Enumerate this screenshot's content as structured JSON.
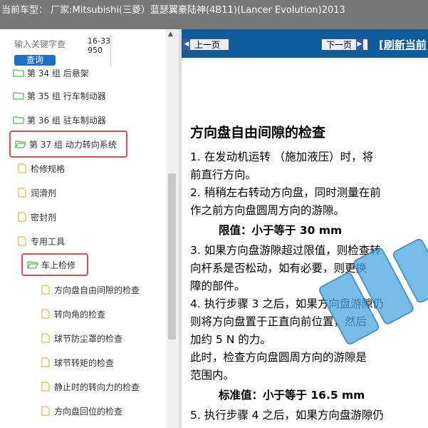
{
  "header": {
    "title": "当前车型： 厂家:Mitsubishi(三菱）蓝瑟翼豪陆神(4B11)(Lancer Evolution)2013"
  },
  "search": {
    "placeholder": "输入关键字查",
    "button_label": "查询",
    "code_text": "16-33950"
  },
  "tree": {
    "groups": [
      {
        "label": "第 34 组 后悬架"
      },
      {
        "label": "第 35 组 行车制动器"
      },
      {
        "label": "第 36 组 驻车制动器"
      },
      {
        "label": "第 37 组 动力转向系统"
      }
    ],
    "children": [
      {
        "label": "检修规格"
      },
      {
        "label": "润滑剂"
      },
      {
        "label": "密封剂"
      },
      {
        "label": "专用工具"
      }
    ],
    "subfolder": {
      "label": "车上检修"
    },
    "leaves": [
      {
        "label": "方向盘自由间隙的检查"
      },
      {
        "label": "转向角的检查"
      },
      {
        "label": "球节防尘罩的检查"
      },
      {
        "label": "球节转矩的检查"
      },
      {
        "label": "静止时的转向力的检查"
      },
      {
        "label": "方向盘回位的检查"
      }
    ]
  },
  "nav": {
    "prev_label": "上一页",
    "next_label": "下一页",
    "refresh_label": "[刷新当前"
  },
  "document": {
    "heading": "方向盘自由间隙的检查",
    "lines": [
      "1. 在发动机运转 （施加液压）时，将",
      "   前直行方向。",
      "2. 稍稍左右转动方向盘，同时测量在前",
      "   作之前方向盘圆周方向的游隙。",
      "限值：小于等于 30 mm",
      "3. 如果方向盘游隙超过限值，则检查转",
      "   向杆系是否松动，如有必要，则更换",
      "   障的部件。",
      "4. 执行步骤 3 之后，如果方向盘游隙仍",
      "   则将方向盘置于正直向前位置，然后",
      "   加约 5 N 的力。",
      "   此时，检查方向盘圆周方向的游隙是",
      "   范围内。",
      "标准值：小于等于 16.5 mm",
      "5. 执行步骤 4 之后，如果方向盘游隙仍"
    ]
  },
  "colors": {
    "highlight": "#e04b5a",
    "nav_bg": "#0d5d9e",
    "folder": "#5cb85c",
    "page_icon": "#e8b347"
  }
}
